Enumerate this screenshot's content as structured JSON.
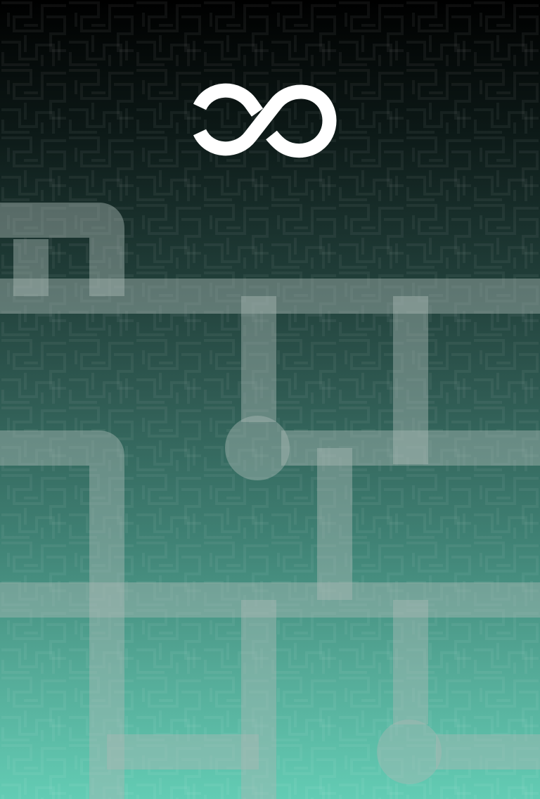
{
  "screen": {
    "name": "infinity-loop-title-screen"
  },
  "logo": {
    "icon": "infinity-icon",
    "color": "#ffffff"
  },
  "theme": {
    "background_top": "#000000",
    "background_bottom": "#63ccb4",
    "pipe_color": "#a8b8b3",
    "pipe_opacity": 0.45
  },
  "board": {
    "pieces": [
      {
        "kind": "corner",
        "id": "corner-top-left"
      },
      {
        "kind": "corner",
        "id": "corner-top-left-inner"
      },
      {
        "kind": "straight",
        "id": "horizontal-row-1"
      },
      {
        "kind": "straight",
        "id": "vertical-col-2-top"
      },
      {
        "kind": "endpoint",
        "id": "endpoint-center"
      },
      {
        "kind": "straight",
        "id": "vertical-col-4-top"
      },
      {
        "kind": "corner",
        "id": "corner-mid-left"
      },
      {
        "kind": "straight",
        "id": "horizontal-row-2"
      },
      {
        "kind": "straight",
        "id": "vertical-col-3-mid"
      },
      {
        "kind": "straight",
        "id": "horizontal-row-3"
      },
      {
        "kind": "straight",
        "id": "vertical-col-1-bottom"
      },
      {
        "kind": "straight",
        "id": "vertical-col-2-bottom"
      },
      {
        "kind": "straight",
        "id": "vertical-col-4-bottom"
      },
      {
        "kind": "endpoint",
        "id": "endpoint-bottom-right"
      },
      {
        "kind": "straight",
        "id": "horizontal-row-4-left"
      },
      {
        "kind": "straight",
        "id": "horizontal-row-4-right"
      }
    ]
  }
}
